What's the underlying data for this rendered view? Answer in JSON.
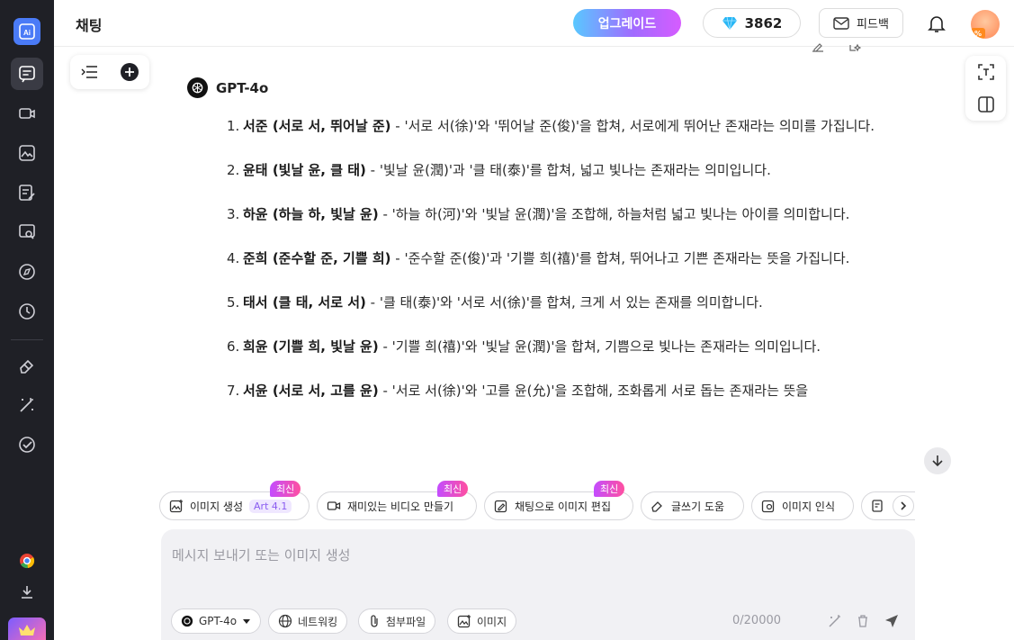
{
  "header": {
    "title": "채팅",
    "upgrade_label": "업그레이드",
    "credits": "3862",
    "feedback_label": "피드백",
    "avatar_badge": "%"
  },
  "rail": {
    "logo_text": "Ai",
    "items": [
      "chat-icon",
      "video-icon",
      "image-icon",
      "write-icon",
      "search-chat-icon",
      "compass-icon",
      "history-icon",
      "eraser-icon",
      "magic-wand-icon",
      "check-circle-icon",
      "chrome-icon",
      "download-icon"
    ]
  },
  "chat": {
    "model_name": "GPT-4o",
    "items": [
      {
        "num": "1.",
        "bold": "서준 (서로 서, 뛰어날 준)",
        "rest": " - '서로 서(徐)'와 '뛰어날 준(俊)'을 합쳐, 서로에게 뛰어난 존재라는 의미를 가집니다."
      },
      {
        "num": "2.",
        "bold": "윤태 (빛날 윤, 클 태)",
        "rest": " - '빛날 윤(潤)'과 '클 태(泰)'를 합쳐, 넓고 빛나는 존재라는 의미입니다."
      },
      {
        "num": "3.",
        "bold": "하윤 (하늘 하, 빛날 윤)",
        "rest": " - '하늘 하(河)'와 '빛날 윤(潤)'을 조합해, 하늘처럼 넓고 빛나는 아이를 의미합니다."
      },
      {
        "num": "4.",
        "bold": "준희 (준수할 준, 기쁠 희)",
        "rest": " - '준수할 준(俊)'과 '기쁠 희(禧)'를 합쳐, 뛰어나고 기쁜 존재라는 뜻을 가집니다."
      },
      {
        "num": "5.",
        "bold": "태서 (클 태, 서로 서)",
        "rest": " - '클 태(泰)'와 '서로 서(徐)'를 합쳐, 크게 서 있는 존재를 의미합니다."
      },
      {
        "num": "6.",
        "bold": "희윤 (기쁠 희, 빛날 윤)",
        "rest": " - '기쁠 희(禧)'와 '빛날 윤(潤)'을 합쳐, 기쁨으로 빛나는 존재라는 의미입니다."
      },
      {
        "num": "7.",
        "bold": "서윤 (서로 서, 고를 윤)",
        "rest": " - '서로 서(徐)'와 '고를 윤(允)'을 조합해, 조화롭게 서로 돕는 존재라는 뜻을"
      }
    ]
  },
  "chips": {
    "image_gen": {
      "label": "이미지 생성",
      "tag": "Art 4.1",
      "badge": "최신"
    },
    "fun_video": {
      "label": "재미있는 비디오 만들기",
      "badge": "최신"
    },
    "chat_edit": {
      "label": "채팅으로 이미지 편집",
      "badge": "최신"
    },
    "writing": {
      "label": "글쓰기 도움"
    },
    "image_recog": {
      "label": "이미지 인식"
    }
  },
  "composer": {
    "placeholder": "메시지 보내기 또는 이미지 생성",
    "model_label": "GPT-4o",
    "network_label": "네트워킹",
    "attach_label": "첨부파일",
    "image_label": "이미지",
    "counter": "0/20000"
  },
  "colors": {
    "rail_bg": "#1f2026",
    "accent": "#4a7bf7",
    "badge_gradient_start": "#c34dff",
    "badge_gradient_end": "#ff4fa0"
  }
}
